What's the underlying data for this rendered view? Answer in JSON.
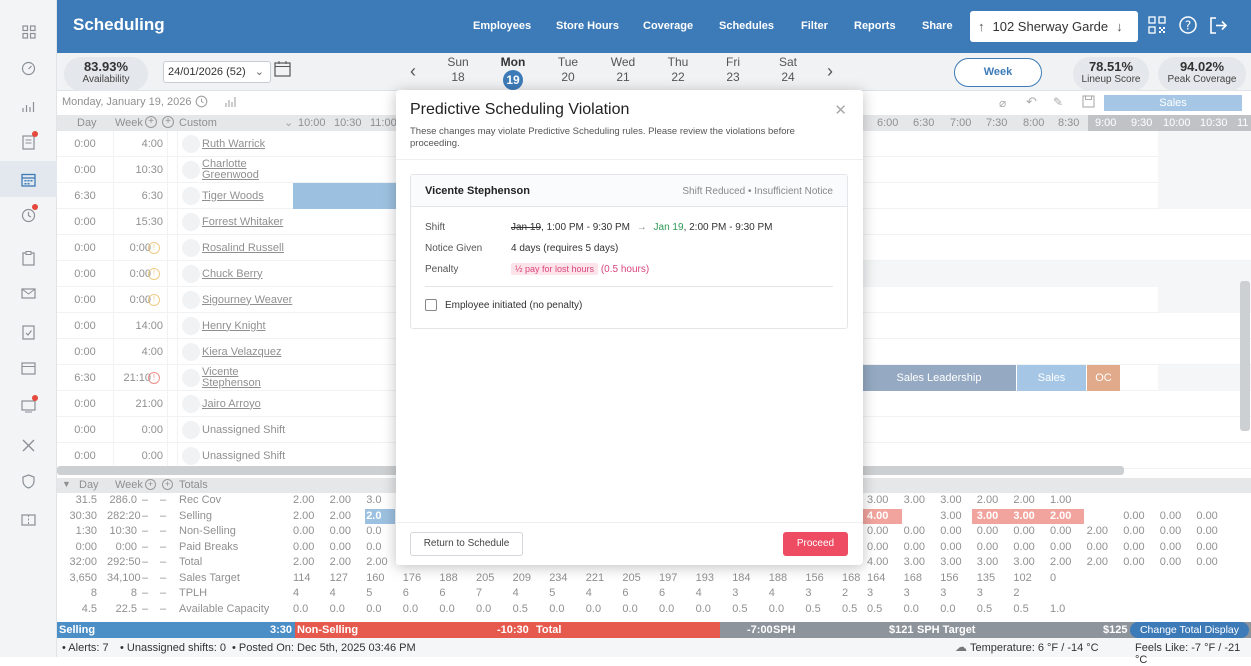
{
  "app": {
    "title": "Scheduling"
  },
  "nav": [
    "Employees",
    "Store Hours",
    "Coverage",
    "Schedules",
    "Filter",
    "Reports",
    "Share"
  ],
  "store": {
    "name": "102 Sherway Garde"
  },
  "availability": {
    "value": "83.93%",
    "label": "Availability"
  },
  "week_select": {
    "value": "24/01/2026 (52)"
  },
  "days": [
    {
      "w": "Sun",
      "d": "18"
    },
    {
      "w": "Mon",
      "d": "19"
    },
    {
      "w": "Tue",
      "d": "20"
    },
    {
      "w": "Wed",
      "d": "21"
    },
    {
      "w": "Thu",
      "d": "22"
    },
    {
      "w": "Fri",
      "d": "23"
    },
    {
      "w": "Sat",
      "d": "24"
    }
  ],
  "view_button": "Week",
  "lineup": {
    "value": "78.51%",
    "label": "Lineup Score"
  },
  "peak": {
    "value": "94.02%",
    "label": "Peak Coverage"
  },
  "date_line": "Monday, January 19, 2026",
  "grid_header": {
    "day": "Day",
    "week": "Week",
    "custom": "Custom",
    "times_left": [
      "10:00",
      "10:30",
      "11:00"
    ],
    "times_right": [
      "6:00",
      "6:30",
      "7:00",
      "7:30",
      "8:00",
      "8:30",
      "9:00",
      "9:30",
      "10:00",
      "10:30",
      "11"
    ],
    "dept": "Sales"
  },
  "employees": [
    {
      "day": "0:00",
      "week": "4:00",
      "name": "Ruth Warrick",
      "warn": ""
    },
    {
      "day": "0:00",
      "week": "10:30",
      "name": "Charlotte Greenwood",
      "warn": ""
    },
    {
      "day": "6:30",
      "week": "6:30",
      "name": "Tiger Woods",
      "warn": ""
    },
    {
      "day": "0:00",
      "week": "15:30",
      "name": "Forrest Whitaker",
      "warn": ""
    },
    {
      "day": "0:00",
      "week": "0:00",
      "name": "Rosalind Russell",
      "warn": "amber"
    },
    {
      "day": "0:00",
      "week": "0:00",
      "name": "Chuck Berry",
      "warn": "amber"
    },
    {
      "day": "0:00",
      "week": "0:00",
      "name": "Sigourney Weaver",
      "warn": "amber"
    },
    {
      "day": "0:00",
      "week": "14:00",
      "name": "Henry Knight",
      "warn": ""
    },
    {
      "day": "0:00",
      "week": "4:00",
      "name": "Kiera Velazquez",
      "warn": ""
    },
    {
      "day": "6:30",
      "week": "21:10",
      "name": "Vicente Stephenson",
      "warn": "red"
    },
    {
      "day": "0:00",
      "week": "21:00",
      "name": "Jairo Arroyo",
      "warn": ""
    },
    {
      "day": "0:00",
      "week": "0:00",
      "name": "Unassigned Shift",
      "warn": ""
    },
    {
      "day": "0:00",
      "week": "0:00",
      "name": "Unassigned Shift",
      "warn": ""
    }
  ],
  "shift_bars": {
    "sales_leadership": "Sales Leadership",
    "sales": "Sales",
    "oc": "OC"
  },
  "totals_header": {
    "day": "Day",
    "week": "Week",
    "label": "Totals"
  },
  "totals": [
    {
      "day": "31.5",
      "week": "286.0",
      "label": "Rec Cov",
      "left": [
        "2.00",
        "2.00",
        "3.0"
      ],
      "right": [
        "3.00",
        "3.00",
        "3.00",
        "2.00",
        "2.00",
        "1.00",
        "",
        "",
        "",
        ""
      ]
    },
    {
      "day": "30:30",
      "week": "282:20",
      "label": "Selling",
      "left": [
        "2.00",
        "2.00",
        "2.0"
      ],
      "right": [
        "4.00",
        "3.00",
        "3.00",
        "3.00",
        "3.00",
        "2.00",
        "0.00",
        "0.00",
        "0.00",
        "0.00"
      ]
    },
    {
      "day": "1:30",
      "week": "10:30",
      "label": "Non-Selling",
      "left": [
        "0.00",
        "0.00",
        "0.0"
      ],
      "right": [
        "0.00",
        "0.00",
        "0.00",
        "0.00",
        "0.00",
        "0.00",
        "2.00",
        "0.00",
        "0.00",
        "0.00"
      ]
    },
    {
      "day": "0:00",
      "week": "0:00",
      "label": "Paid Breaks",
      "left": [
        "0.00",
        "0.00",
        "0.0"
      ],
      "right": [
        "0.00",
        "0.00",
        "0.00",
        "0.00",
        "0.00",
        "0.00",
        "0.00",
        "0.00",
        "0.00",
        "0.00"
      ]
    },
    {
      "day": "32:00",
      "week": "292:50",
      "label": "Total",
      "left": [
        "2.00",
        "2.00",
        "2.00",
        "2.00",
        "2.00",
        "2.00",
        "3.00",
        "3.00",
        "3.00",
        "2.00",
        "2.00",
        "3.00",
        "4.00",
        "3.00",
        "4.00",
        "4.00"
      ],
      "right": [
        "4.00",
        "3.00",
        "3.00",
        "3.00",
        "3.00",
        "2.00",
        "2.00",
        "0.00",
        "0.00",
        "0.00"
      ]
    },
    {
      "day": "3,650",
      "week": "34,100",
      "label": "Sales Target",
      "left": [
        "114",
        "127",
        "160",
        "176",
        "188",
        "205",
        "209",
        "234",
        "221",
        "205",
        "197",
        "193",
        "184",
        "188",
        "156",
        "168"
      ],
      "right": [
        "164",
        "168",
        "156",
        "135",
        "102",
        "0",
        "",
        "",
        "",
        ""
      ]
    },
    {
      "day": "8",
      "week": "8",
      "label": "TPLH",
      "left": [
        "4",
        "4",
        "5",
        "6",
        "6",
        "7",
        "4",
        "5",
        "4",
        "6",
        "6",
        "4",
        "3",
        "4",
        "3",
        "2"
      ],
      "right": [
        "3",
        "3",
        "3",
        "3",
        "2",
        "",
        "",
        "",
        "",
        ""
      ]
    },
    {
      "day": "4.5",
      "week": "22.5",
      "label": "Available Capacity",
      "left": [
        "0.0",
        "0.0",
        "0.0",
        "0.0",
        "0.0",
        "0.0",
        "0.5",
        "0.0",
        "0.0",
        "0.0",
        "0.0",
        "0.0",
        "0.5",
        "0.0",
        "0.5",
        "0.5"
      ],
      "right": [
        "0.5",
        "0.0",
        "0.0",
        "0.5",
        "0.5",
        "1.0",
        "",
        "",
        "",
        ""
      ]
    }
  ],
  "bottom": {
    "selling": "Selling",
    "selling_val": "3:30",
    "nonselling": "Non-Selling",
    "nonselling_val": "-10:30",
    "total": "Total",
    "total_val": "-7:00",
    "sph": "SPH",
    "sph_val": "$121",
    "sph_target": "SPH Target",
    "sph_target_val": "$125",
    "change_display": "Change Total Display"
  },
  "footer": {
    "alerts": "• Alerts: 7",
    "unassigned": "• Unassigned shifts: 0",
    "posted": "• Posted On: Dec 5th, 2025 03:46 PM",
    "temp": "Temperature: 6 °F / -14 °C",
    "feels": "Feels Like: -7 °F / -21 °C"
  },
  "modal": {
    "title": "Predictive Scheduling Violation",
    "subtitle": "These changes may violate Predictive Scheduling rules. Please review the violations before proceeding.",
    "employee": "Vicente Stephenson",
    "tags": "Shift Reduced • Insufficient Notice",
    "shift_label": "Shift",
    "shift_old_date": "Jan 19",
    "shift_old_time": ", 1:00 PM - 9:30 PM",
    "arrow": "→",
    "shift_new_date": "Jan 19",
    "shift_new_time": ", 2:00 PM - 9:30 PM",
    "notice_label": "Notice Given",
    "notice_value": "4 days (requires 5 days)",
    "penalty_label": "Penalty",
    "penalty_badge": "½ pay for lost hours",
    "penalty_hours": "(0.5 hours)",
    "checkbox_label": "Employee initiated (no penalty)",
    "return_button": "Return to Schedule",
    "proceed_button": "Proceed"
  },
  "colors": {
    "brand": "#3d7bb8",
    "danger": "#ee4c63",
    "selling_bar": "#4c8fc7",
    "sales_leadership": "#3f6491",
    "oc": "#c9652b"
  }
}
